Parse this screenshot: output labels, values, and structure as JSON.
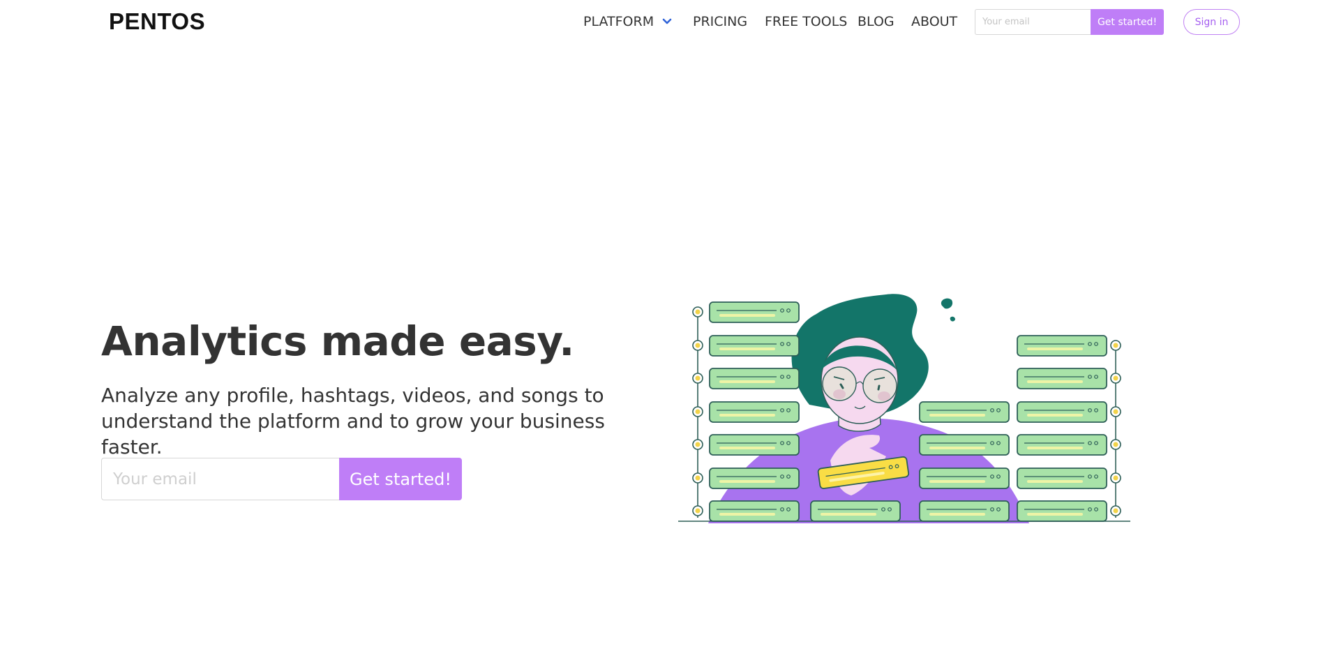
{
  "header": {
    "logo": "PENTOS",
    "nav": {
      "platform": "PLATFORM",
      "pricing": "PRICING",
      "free_tools": "FREE TOOLS",
      "blog": "BLOG",
      "about": "ABOUT"
    },
    "email_placeholder": "Your email",
    "cta_label": "Get started!",
    "signin_label": "Sign in"
  },
  "hero": {
    "title": "Analytics made easy.",
    "subtitle": "Analyze any profile, hashtags, videos, and songs to understand the platform and to grow your business faster.",
    "email_placeholder": "Your email",
    "cta_label": "Get started!"
  },
  "icons": {
    "platform_dropdown": "chevron-down-icon"
  },
  "colors": {
    "accent": "#bf7ef7",
    "signin_border": "#c081f3",
    "chevron": "#2f63d8",
    "text": "#333333",
    "illustration_hair": "#137569",
    "illustration_shirt": "#a873ef",
    "illustration_card": "#a8e2a8",
    "illustration_highlight": "#f9dd45"
  }
}
